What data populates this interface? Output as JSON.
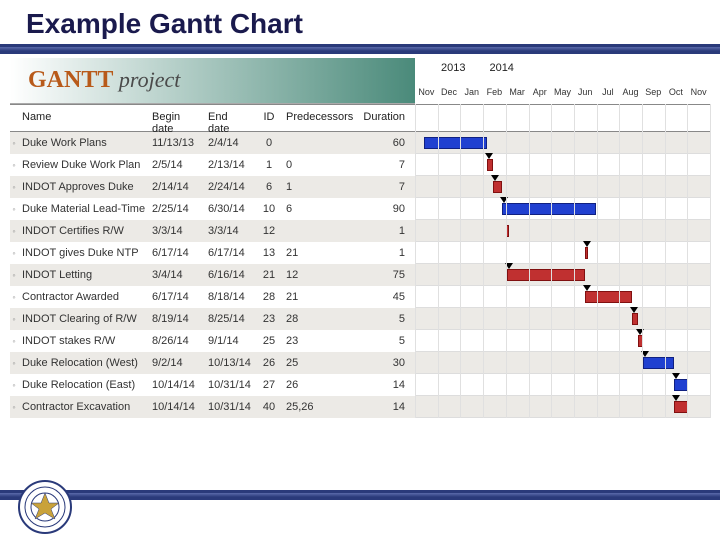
{
  "slide_title": "Example Gantt Chart",
  "logo": {
    "brand_bold": "GANTT",
    "brand_sub": "project"
  },
  "table": {
    "headers": {
      "name": "Name",
      "begin": "Begin date",
      "end": "End date",
      "id": "ID",
      "pred": "Predecessors",
      "dur": "Duration"
    },
    "rows": [
      {
        "name": "Duke Work Plans",
        "begin": "11/13/13",
        "end": "2/4/14",
        "id": "0",
        "pred": "",
        "dur": "60"
      },
      {
        "name": "Review Duke Work Plan",
        "begin": "2/5/14",
        "end": "2/13/14",
        "id": "1",
        "pred": "0",
        "dur": "7"
      },
      {
        "name": "INDOT Approves Duke",
        "begin": "2/14/14",
        "end": "2/24/14",
        "id": "6",
        "pred": "1",
        "dur": "7"
      },
      {
        "name": "Duke Material Lead-Time",
        "begin": "2/25/14",
        "end": "6/30/14",
        "id": "10",
        "pred": "6",
        "dur": "90"
      },
      {
        "name": "INDOT Certifies R/W",
        "begin": "3/3/14",
        "end": "3/3/14",
        "id": "12",
        "pred": "",
        "dur": "1"
      },
      {
        "name": "INDOT gives Duke NTP",
        "begin": "6/17/14",
        "end": "6/17/14",
        "id": "13",
        "pred": "21",
        "dur": "1"
      },
      {
        "name": "INDOT Letting",
        "begin": "3/4/14",
        "end": "6/16/14",
        "id": "21",
        "pred": "12",
        "dur": "75"
      },
      {
        "name": "Contractor Awarded",
        "begin": "6/17/14",
        "end": "8/18/14",
        "id": "28",
        "pred": "21",
        "dur": "45"
      },
      {
        "name": "INDOT Clearing of R/W",
        "begin": "8/19/14",
        "end": "8/25/14",
        "id": "23",
        "pred": "28",
        "dur": "5"
      },
      {
        "name": "INDOT stakes R/W",
        "begin": "8/26/14",
        "end": "9/1/14",
        "id": "25",
        "pred": "23",
        "dur": "5"
      },
      {
        "name": "Duke Relocation (West)",
        "begin": "9/2/14",
        "end": "10/13/14",
        "id": "26",
        "pred": "25",
        "dur": "30"
      },
      {
        "name": "Duke Relocation (East)",
        "begin": "10/14/14",
        "end": "10/31/14",
        "id": "27",
        "pred": "26",
        "dur": "14"
      },
      {
        "name": "Contractor Excavation",
        "begin": "10/14/14",
        "end": "10/31/14",
        "id": "40",
        "pred": "25,26",
        "dur": "14"
      }
    ]
  },
  "timeline": {
    "years": [
      "2013",
      "2014"
    ],
    "months": [
      "Nov",
      "Dec",
      "Jan",
      "Feb",
      "Mar",
      "Apr",
      "May",
      "Jun",
      "Jul",
      "Aug",
      "Sep",
      "Oct",
      "Nov"
    ]
  },
  "chart_data": {
    "type": "gantt",
    "title": "Example Gantt Chart",
    "x_unit": "month",
    "x_range": [
      "2013-11",
      "2014-11"
    ],
    "tasks": [
      {
        "id": "0",
        "name": "Duke Work Plans",
        "start": "2013-11-13",
        "end": "2014-02-04",
        "duration_days": 60,
        "predecessors": [],
        "color": "blue"
      },
      {
        "id": "1",
        "name": "Review Duke Work Plan",
        "start": "2014-02-05",
        "end": "2014-02-13",
        "duration_days": 7,
        "predecessors": [
          "0"
        ],
        "color": "red"
      },
      {
        "id": "6",
        "name": "INDOT Approves Duke",
        "start": "2014-02-14",
        "end": "2014-02-24",
        "duration_days": 7,
        "predecessors": [
          "1"
        ],
        "color": "red"
      },
      {
        "id": "10",
        "name": "Duke Material Lead-Time",
        "start": "2014-02-25",
        "end": "2014-06-30",
        "duration_days": 90,
        "predecessors": [
          "6"
        ],
        "color": "blue"
      },
      {
        "id": "12",
        "name": "INDOT Certifies R/W",
        "start": "2014-03-03",
        "end": "2014-03-03",
        "duration_days": 1,
        "predecessors": [],
        "color": "red"
      },
      {
        "id": "13",
        "name": "INDOT gives Duke NTP",
        "start": "2014-06-17",
        "end": "2014-06-17",
        "duration_days": 1,
        "predecessors": [
          "21"
        ],
        "color": "red"
      },
      {
        "id": "21",
        "name": "INDOT Letting",
        "start": "2014-03-04",
        "end": "2014-06-16",
        "duration_days": 75,
        "predecessors": [
          "12"
        ],
        "color": "red"
      },
      {
        "id": "28",
        "name": "Contractor Awarded",
        "start": "2014-06-17",
        "end": "2014-08-18",
        "duration_days": 45,
        "predecessors": [
          "21"
        ],
        "color": "red"
      },
      {
        "id": "23",
        "name": "INDOT Clearing of R/W",
        "start": "2014-08-19",
        "end": "2014-08-25",
        "duration_days": 5,
        "predecessors": [
          "28"
        ],
        "color": "red"
      },
      {
        "id": "25",
        "name": "INDOT stakes R/W",
        "start": "2014-08-26",
        "end": "2014-09-01",
        "duration_days": 5,
        "predecessors": [
          "23"
        ],
        "color": "red"
      },
      {
        "id": "26",
        "name": "Duke Relocation (West)",
        "start": "2014-09-02",
        "end": "2014-10-13",
        "duration_days": 30,
        "predecessors": [
          "25"
        ],
        "color": "blue"
      },
      {
        "id": "27",
        "name": "Duke Relocation (East)",
        "start": "2014-10-14",
        "end": "2014-10-31",
        "duration_days": 14,
        "predecessors": [
          "26"
        ],
        "color": "blue"
      },
      {
        "id": "40",
        "name": "Contractor Excavation",
        "start": "2014-10-14",
        "end": "2014-10-31",
        "duration_days": 14,
        "predecessors": [
          "25",
          "26"
        ],
        "color": "red"
      }
    ]
  },
  "seal_label": "INDIANA DEPT OF TRANSPORTATION"
}
